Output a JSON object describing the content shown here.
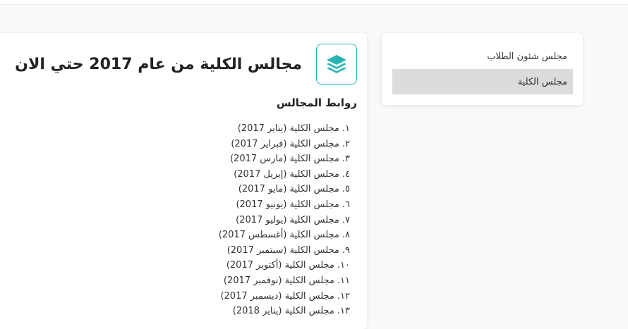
{
  "main": {
    "title": "مجالس الكلية من عام 2017 حتي الان",
    "section_title": "روابط المجالس",
    "links": [
      {
        "num": "١.",
        "label": "مجلس الكلية (يناير 2017)"
      },
      {
        "num": "٢.",
        "label": "مجلس الكلية (فبراير 2017)"
      },
      {
        "num": "٣.",
        "label": "مجلس الكلية (مارس 2017)"
      },
      {
        "num": "٤.",
        "label": "مجلس الكلية (إبريل 2017)"
      },
      {
        "num": "٥.",
        "label": "مجلس الكلية (مايو 2017)"
      },
      {
        "num": "٦.",
        "label": "مجلس الكلية (يونيو 2017)"
      },
      {
        "num": "٧.",
        "label": "مجلس الكلية (يوليو 2017)"
      },
      {
        "num": "٨.",
        "label": "مجلس الكلية (أغسطس 2017)"
      },
      {
        "num": "٩.",
        "label": "مجلس الكلية (سبتمبر 2017)"
      },
      {
        "num": "١٠.",
        "label": "مجلس الكلية (أكتوبر 2017)"
      },
      {
        "num": "١١.",
        "label": "مجلس الكلية (نوفمبر 2017)"
      },
      {
        "num": "١٢.",
        "label": "مجلس الكلية (ديسمبر 2017)"
      },
      {
        "num": "١٣.",
        "label": "مجلس الكلية (يناير 2018)"
      }
    ],
    "icon": "layers-icon"
  },
  "sidebar": {
    "items": [
      {
        "label": "مجلس شئون الطلاب",
        "active": false
      },
      {
        "label": "مجلس الكلية",
        "active": true
      }
    ]
  },
  "colors": {
    "accent": "#2ab3b5",
    "active_bg": "#dcdcdc"
  }
}
